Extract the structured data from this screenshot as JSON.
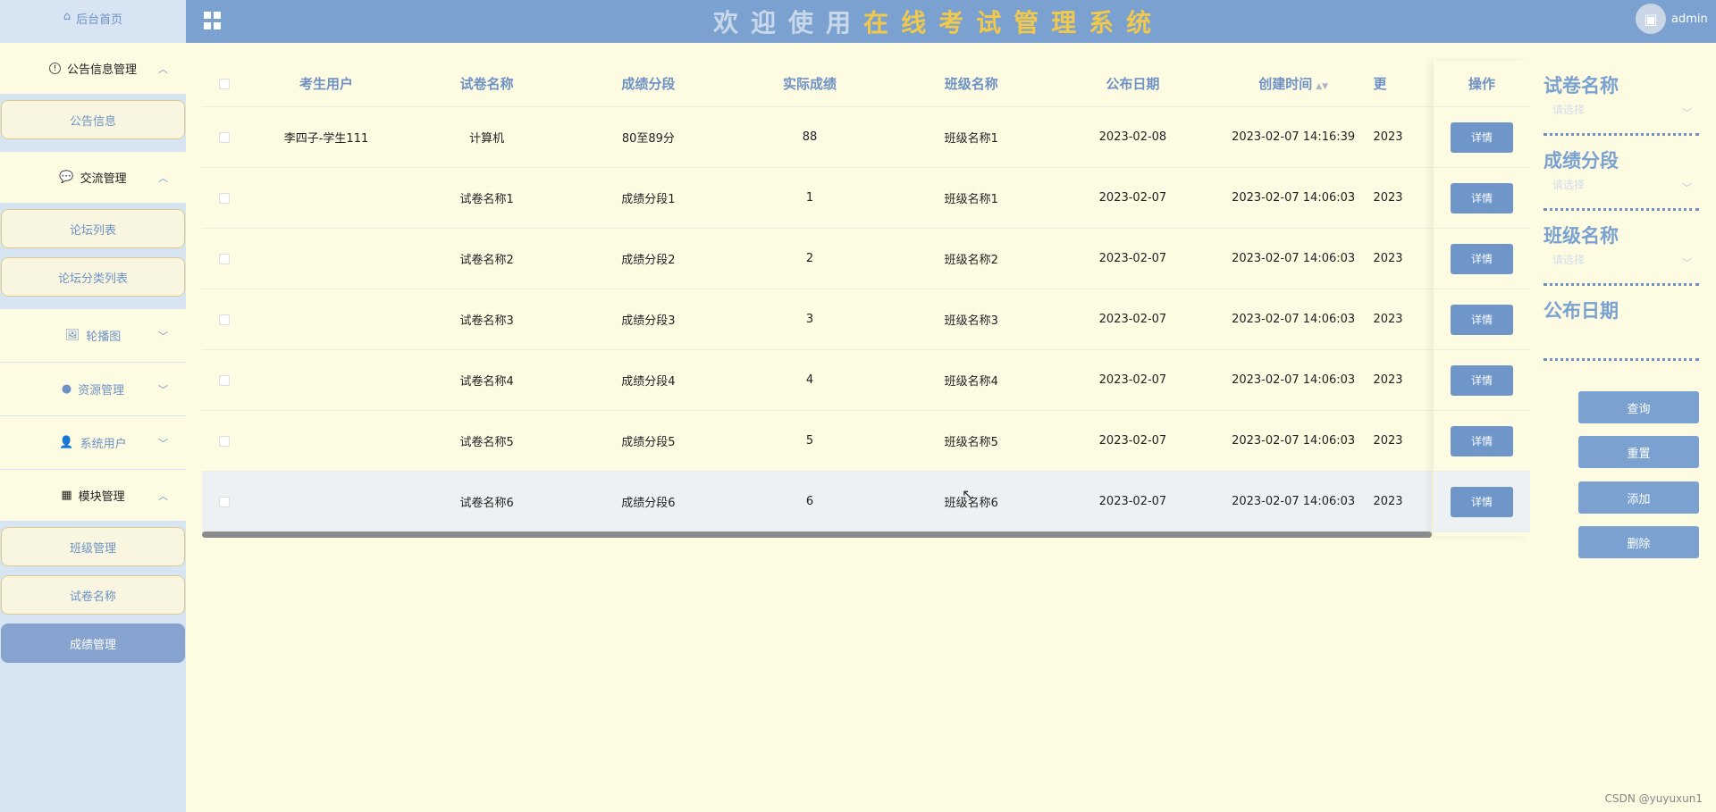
{
  "header": {
    "title": "欢迎使用在线考试管理系统",
    "user": "admin"
  },
  "sidebar": {
    "home": "后台首页",
    "groups": [
      {
        "label": "公告信息管理",
        "items": [
          "公告信息"
        ]
      },
      {
        "label": "交流管理",
        "items": [
          "论坛列表",
          "论坛分类列表"
        ]
      },
      {
        "label": "轮播图",
        "items": []
      },
      {
        "label": "资源管理",
        "items": []
      },
      {
        "label": "系统用户",
        "items": []
      },
      {
        "label": "模块管理",
        "items": [
          "班级管理",
          "试卷名称",
          "成绩管理"
        ]
      }
    ]
  },
  "table": {
    "headers": [
      "考生用户",
      "试卷名称",
      "成绩分段",
      "实际成绩",
      "班级名称",
      "公布日期",
      "创建时间",
      "更"
    ],
    "op_header": "操作",
    "op_button": "详情",
    "rows": [
      [
        "李四子-学生111",
        "计算机",
        "80至89分",
        "88",
        "班级名称1",
        "2023-02-08",
        "2023-02-07 14:16:39",
        "2023"
      ],
      [
        "",
        "试卷名称1",
        "成绩分段1",
        "1",
        "班级名称1",
        "2023-02-07",
        "2023-02-07 14:06:03",
        "2023"
      ],
      [
        "",
        "试卷名称2",
        "成绩分段2",
        "2",
        "班级名称2",
        "2023-02-07",
        "2023-02-07 14:06:03",
        "2023"
      ],
      [
        "",
        "试卷名称3",
        "成绩分段3",
        "3",
        "班级名称3",
        "2023-02-07",
        "2023-02-07 14:06:03",
        "2023"
      ],
      [
        "",
        "试卷名称4",
        "成绩分段4",
        "4",
        "班级名称4",
        "2023-02-07",
        "2023-02-07 14:06:03",
        "2023"
      ],
      [
        "",
        "试卷名称5",
        "成绩分段5",
        "5",
        "班级名称5",
        "2023-02-07",
        "2023-02-07 14:06:03",
        "2023"
      ],
      [
        "",
        "试卷名称6",
        "成绩分段6",
        "6",
        "班级名称6",
        "2023-02-07",
        "2023-02-07 14:06:03",
        "2023"
      ]
    ]
  },
  "filter": {
    "paper_label": "试卷名称",
    "segment_label": "成绩分段",
    "class_label": "班级名称",
    "date_label": "公布日期",
    "placeholder": "请选择",
    "query": "查询",
    "reset": "重置",
    "add": "添加",
    "delete": "删除"
  },
  "footer": "CSDN @yuyuxun1"
}
